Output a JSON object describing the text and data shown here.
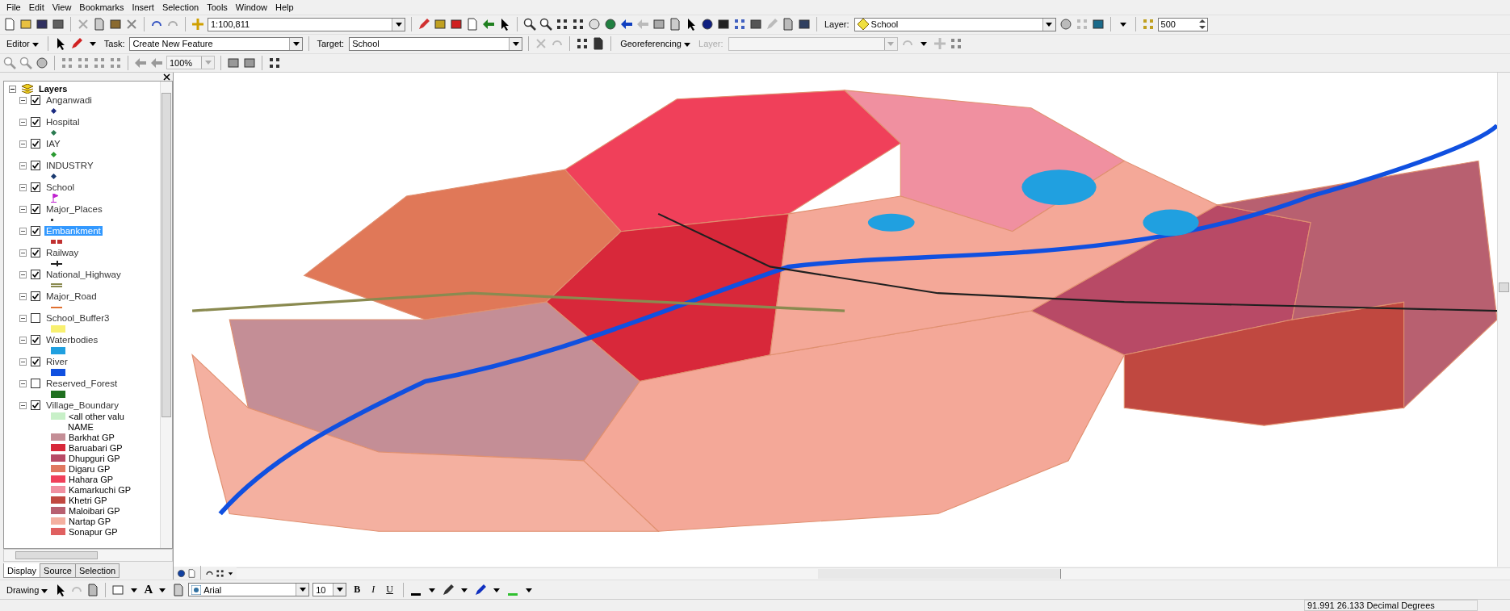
{
  "menu": [
    {
      "label": "File"
    },
    {
      "label": "Edit"
    },
    {
      "label": "View"
    },
    {
      "label": "Bookmarks"
    },
    {
      "label": "Insert"
    },
    {
      "label": "Selection"
    },
    {
      "label": "Tools"
    },
    {
      "label": "Window"
    },
    {
      "label": "Help"
    }
  ],
  "standard_toolbar": {
    "scale": "1:100,811",
    "layer_label": "Layer:",
    "layer": "School",
    "snap_value": "500"
  },
  "editor_toolbar": {
    "editor": "Editor",
    "task_label": "Task:",
    "task": "Create New Feature",
    "target_label": "Target:",
    "target": "School",
    "georeferencing": "Georeferencing",
    "layer_label": "Layer:"
  },
  "layout_toolbar": {
    "zoom": "100%"
  },
  "toc": {
    "title": "Layers",
    "layers": [
      {
        "name": "Anganwadi",
        "checked": true,
        "selected": false,
        "symbol": {
          "kind": "point",
          "color": "#1a2a80"
        }
      },
      {
        "name": "Hospital",
        "checked": true,
        "selected": false,
        "symbol": {
          "kind": "point",
          "color": "#2a7a50"
        }
      },
      {
        "name": "IAY",
        "checked": true,
        "selected": false,
        "symbol": {
          "kind": "point",
          "color": "#2a9a30"
        }
      },
      {
        "name": "INDUSTRY",
        "checked": true,
        "selected": false,
        "symbol": {
          "kind": "point",
          "color": "#1a3a70"
        }
      },
      {
        "name": "School",
        "checked": true,
        "selected": false,
        "symbol": {
          "kind": "flag",
          "color": "#c020d0"
        }
      },
      {
        "name": "Major_Places",
        "checked": true,
        "selected": false,
        "symbol": {
          "kind": "dot",
          "color": "#404040"
        }
      },
      {
        "name": "Embankment",
        "checked": true,
        "selected": true,
        "symbol": {
          "kind": "dashed",
          "color": "#c03030"
        }
      },
      {
        "name": "Railway",
        "checked": true,
        "selected": false,
        "symbol": {
          "kind": "rail",
          "color": "#202020"
        }
      },
      {
        "name": "National_Highway",
        "checked": true,
        "selected": false,
        "symbol": {
          "kind": "double",
          "color": "#8a8a50"
        }
      },
      {
        "name": "Major_Road",
        "checked": true,
        "selected": false,
        "symbol": {
          "kind": "line",
          "color": "#e07030"
        }
      },
      {
        "name": "School_Buffer3",
        "checked": false,
        "selected": false,
        "symbol": {
          "kind": "fill",
          "color": "#f8f070"
        }
      },
      {
        "name": "Waterbodies",
        "checked": true,
        "selected": false,
        "symbol": {
          "kind": "fill",
          "color": "#20a0e0"
        }
      },
      {
        "name": "River",
        "checked": true,
        "selected": false,
        "symbol": {
          "kind": "fill",
          "color": "#1050e0"
        }
      },
      {
        "name": "Reserved_Forest",
        "checked": false,
        "selected": false,
        "symbol": {
          "kind": "fill",
          "color": "#207020"
        }
      },
      {
        "name": "Village_Boundary",
        "checked": true,
        "selected": false
      }
    ],
    "legend": [
      {
        "label": "<all other valu",
        "kind": "swatch",
        "color": "#c8f0c8"
      },
      {
        "label": "NAME",
        "kind": "heading"
      },
      {
        "label": "Barkhat GP",
        "kind": "swatch",
        "color": "#c48e96"
      },
      {
        "label": "Baruabari GP",
        "kind": "swatch",
        "color": "#d8283a"
      },
      {
        "label": "Dhupguri GP",
        "kind": "swatch",
        "color": "#b84a66"
      },
      {
        "label": "Digaru GP",
        "kind": "swatch",
        "color": "#e07860"
      },
      {
        "label": "Hahara GP",
        "kind": "swatch",
        "color": "#f0405a"
      },
      {
        "label": "Kamarkuchi GP",
        "kind": "swatch",
        "color": "#f090a0"
      },
      {
        "label": "Khetri GP",
        "kind": "swatch",
        "color": "#c04840"
      },
      {
        "label": "Maloibari GP",
        "kind": "swatch",
        "color": "#b86070"
      },
      {
        "label": "Nartap GP",
        "kind": "swatch",
        "color": "#f4b0a0"
      },
      {
        "label": "Sonapur GP",
        "kind": "swatch",
        "color": "#e06060"
      }
    ],
    "tabs": [
      {
        "label": "Display",
        "selected": true
      },
      {
        "label": "Source",
        "selected": false
      },
      {
        "label": "Selection",
        "selected": false
      }
    ]
  },
  "drawing_toolbar": {
    "drawing": "Drawing",
    "text_tool": "A",
    "font": "Arial",
    "size": "10",
    "bold": "B",
    "italic": "I",
    "underline": "U"
  },
  "status_bar": {
    "coordinates": "91.991  26.133 Decimal Degrees"
  }
}
